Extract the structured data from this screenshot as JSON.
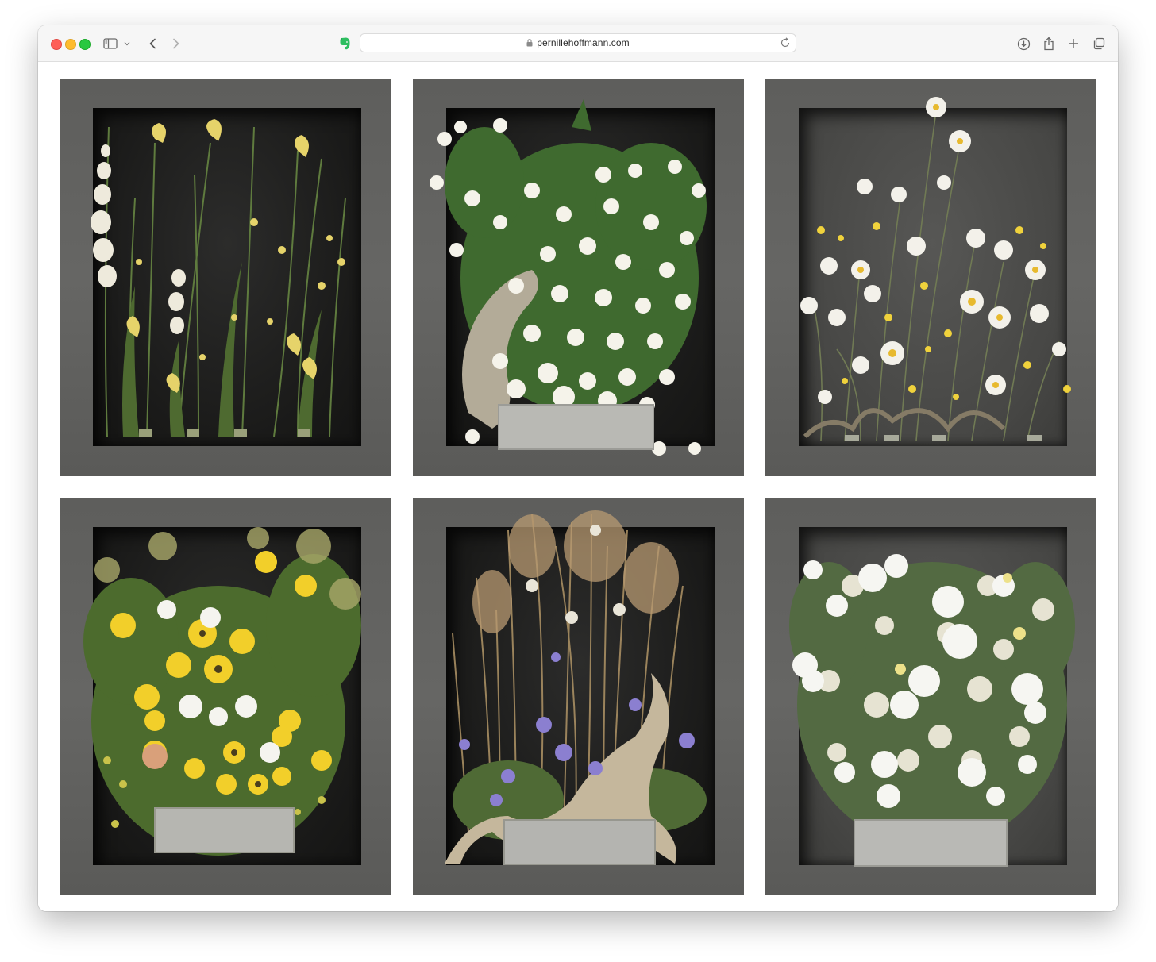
{
  "browser": {
    "url": "pernillehoffmann.com",
    "icons": [
      "sidebar-icon",
      "chevron-down-icon",
      "back-icon",
      "forward-icon",
      "evernote-icon",
      "lock-icon",
      "reload-icon",
      "download-icon",
      "share-icon",
      "new-tab-icon",
      "tab-overview-icon"
    ]
  },
  "gallery": {
    "photos": [
      {
        "name": "yellow-iris-foxglove-arrangement",
        "palette": [
          "#e8d56a",
          "#f2efe2",
          "#5d7a3c"
        ]
      },
      {
        "name": "white-mock-orange-driftwood-arrangement",
        "palette": [
          "#f5f3ea",
          "#4f7a3a",
          "#b9b3a3"
        ]
      },
      {
        "name": "daisy-buttercup-arrangement",
        "palette": [
          "#f3f1ea",
          "#f0d23c",
          "#6f7f52"
        ]
      },
      {
        "name": "yellow-coneflower-dill-arrangement",
        "palette": [
          "#f2cf2a",
          "#f5f4ef",
          "#4c6b2d"
        ]
      },
      {
        "name": "grass-geranium-driftwood-arrangement",
        "palette": [
          "#b89a72",
          "#8b7fd0",
          "#c5b79c"
        ]
      },
      {
        "name": "white-mallow-queen-annes-lace-arrangement",
        "palette": [
          "#f6f6f2",
          "#e6e3d2",
          "#5f7448"
        ]
      }
    ]
  }
}
